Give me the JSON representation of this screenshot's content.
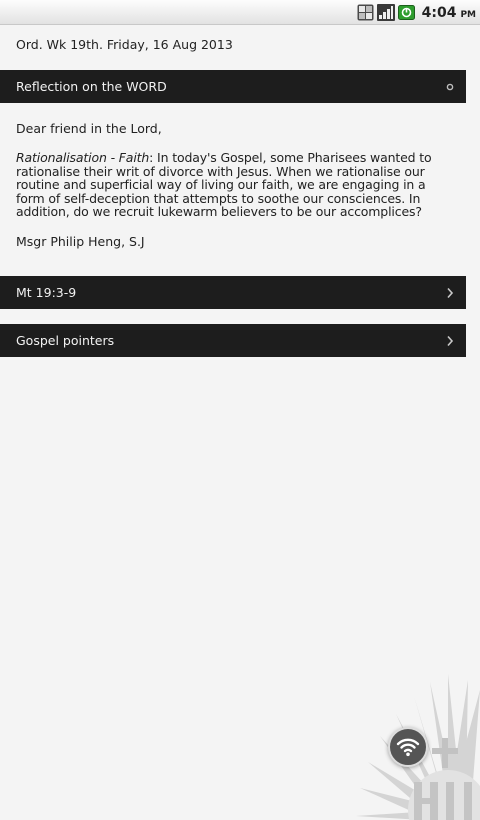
{
  "status_bar": {
    "time": "4:04",
    "ampm": "PM",
    "icons": [
      "data-network-icon",
      "signal-strength-icon",
      "battery-charging-icon"
    ]
  },
  "date_line": "Ord. Wk 19th. Friday, 16 Aug 2013",
  "sections": {
    "reflection": {
      "title": "Reflection on the WORD",
      "icon": "dot-indicator-icon"
    },
    "reading": {
      "title": "Mt 19:3-9",
      "icon": "chevron-right-icon"
    },
    "pointers": {
      "title": "Gospel pointers",
      "icon": "chevron-right-icon"
    }
  },
  "reflection_content": {
    "greeting": "Dear friend in the Lord,",
    "emphasis": "Rationalisation - Faith",
    "body": ": In today's Gospel, some Pharisees wanted to rationalise their writ of divorce with Jesus.  When we rationalise our routine and superficial way of living our faith, we are engaging in a form of self-deception that attempts to soothe our consciences. In addition, do we recruit lukewarm believers to be our accomplices?",
    "author": "Msgr Philip Heng, S.J"
  },
  "colors": {
    "background": "#f4f4f4",
    "bar": "#1d1d1d",
    "bar_text": "#f2f2f2"
  }
}
